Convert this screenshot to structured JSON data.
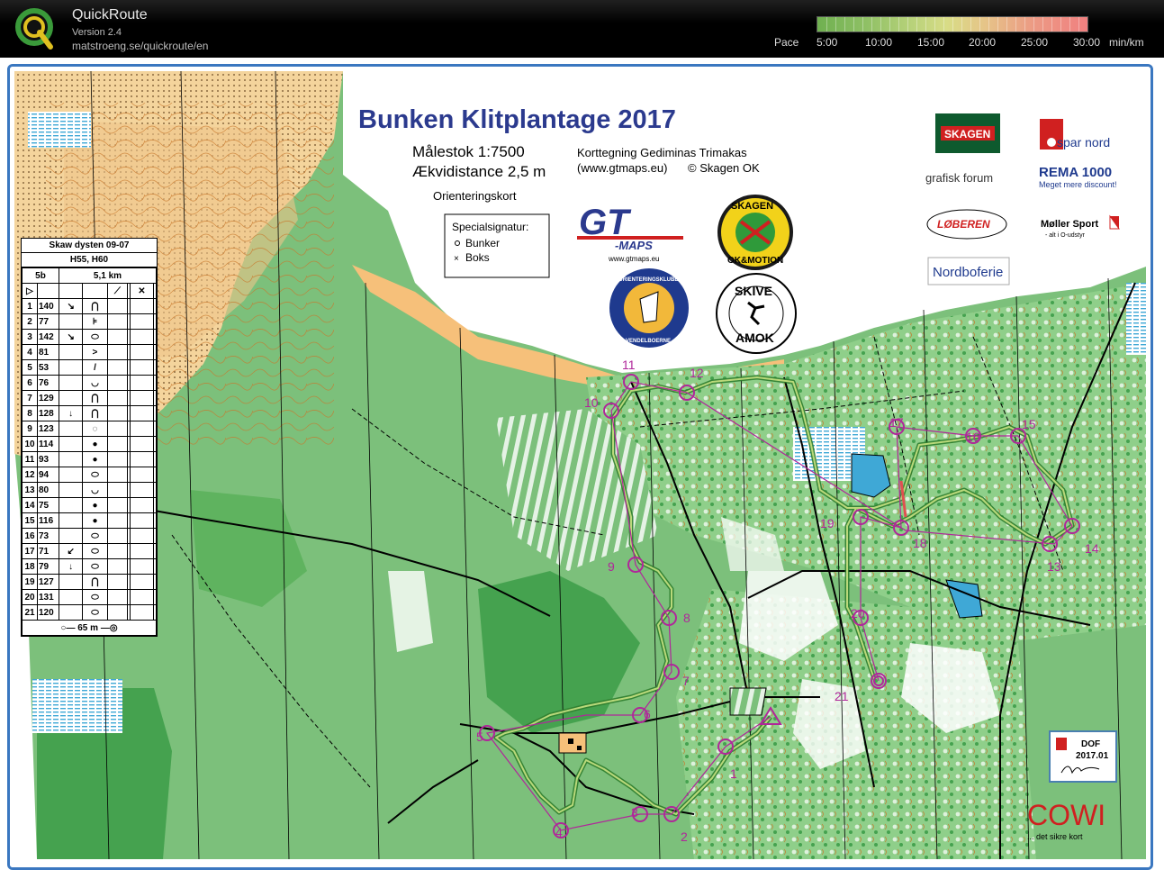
{
  "app": {
    "title": "QuickRoute",
    "version": "Version 2.4",
    "url": "matstroeng.se/quickroute/en"
  },
  "pace_scale": {
    "label": "Pace",
    "ticks": [
      "5:00",
      "10:00",
      "15:00",
      "20:00",
      "25:00",
      "30:00"
    ],
    "unit": "min/km",
    "colors": {
      "fast": "#6fb050",
      "slow": "#f08080"
    }
  },
  "map": {
    "title": "Bunken Klitplantage 2017",
    "scale": "Målestok 1:7500",
    "contour": "Ækvidistance 2,5 m",
    "map_type": "Orienteringskort",
    "credit1": "Korttegning Gediminas Trimakas",
    "credit2": "(www.gtmaps.eu)",
    "credit3": "© Skagen OK",
    "legend_title": "Specialsignatur:",
    "legend_items": [
      "Bunker",
      "Boks"
    ],
    "colors": {
      "forest": "#7cc07b",
      "dense": "#45a24f",
      "open": "#f5dca8",
      "contour": "#c8782c",
      "water": "#3fa8d6",
      "course": "#b0279a"
    }
  },
  "course": {
    "title": "Skaw dysten 09-07",
    "classes": "H55, H60",
    "course_name": "5b",
    "length": "5,1 km",
    "controls": [
      {
        "n": "1",
        "code": "140"
      },
      {
        "n": "2",
        "code": "77"
      },
      {
        "n": "3",
        "code": "142"
      },
      {
        "n": "4",
        "code": "81"
      },
      {
        "n": "5",
        "code": "53"
      },
      {
        "n": "6",
        "code": "76"
      },
      {
        "n": "7",
        "code": "129"
      },
      {
        "n": "8",
        "code": "128"
      },
      {
        "n": "9",
        "code": "123"
      },
      {
        "n": "10",
        "code": "114"
      },
      {
        "n": "11",
        "code": "93"
      },
      {
        "n": "12",
        "code": "94"
      },
      {
        "n": "13",
        "code": "80"
      },
      {
        "n": "14",
        "code": "75"
      },
      {
        "n": "15",
        "code": "116"
      },
      {
        "n": "16",
        "code": "73"
      },
      {
        "n": "17",
        "code": "71"
      },
      {
        "n": "18",
        "code": "79"
      },
      {
        "n": "19",
        "code": "127"
      },
      {
        "n": "20",
        "code": "131"
      },
      {
        "n": "21",
        "code": "120"
      }
    ],
    "finish": "65 m",
    "control_labels": [
      "1",
      "2",
      "3",
      "4",
      "5",
      "6",
      "7",
      "8",
      "9",
      "10",
      "11",
      "12",
      "13",
      "14",
      "15",
      "16",
      "17",
      "18",
      "19",
      "20",
      "21"
    ]
  },
  "sponsors": {
    "gt_maps": "GT",
    "gt_maps_sub": "-MAPS",
    "gt_maps_url": "www.gtmaps.eu",
    "skagen_top": "SKAGEN",
    "skagen_bottom": "OK&MOTION",
    "club_top": "ORIENTERINGSKLUBBEN",
    "club_bottom": "VENDELBOERNE",
    "skive_top": "SKIVE",
    "skive_bottom": "AMOK",
    "skagen_beer": "SKAGEN",
    "spar_nord": "spar nord",
    "grafisk": "grafisk forum",
    "rema": "REMA 1000",
    "rema_sub": "Meget mere discount!",
    "loberen": "LØBEREN",
    "moller": "Møller Sport",
    "moller_sub": "- alt i O-udstyr",
    "nordbo": "Nordboferie",
    "dof": "DOF",
    "dof_year": "2017.01",
    "cowi": "COWI",
    "cowi_sub": "... det sikre kort"
  }
}
